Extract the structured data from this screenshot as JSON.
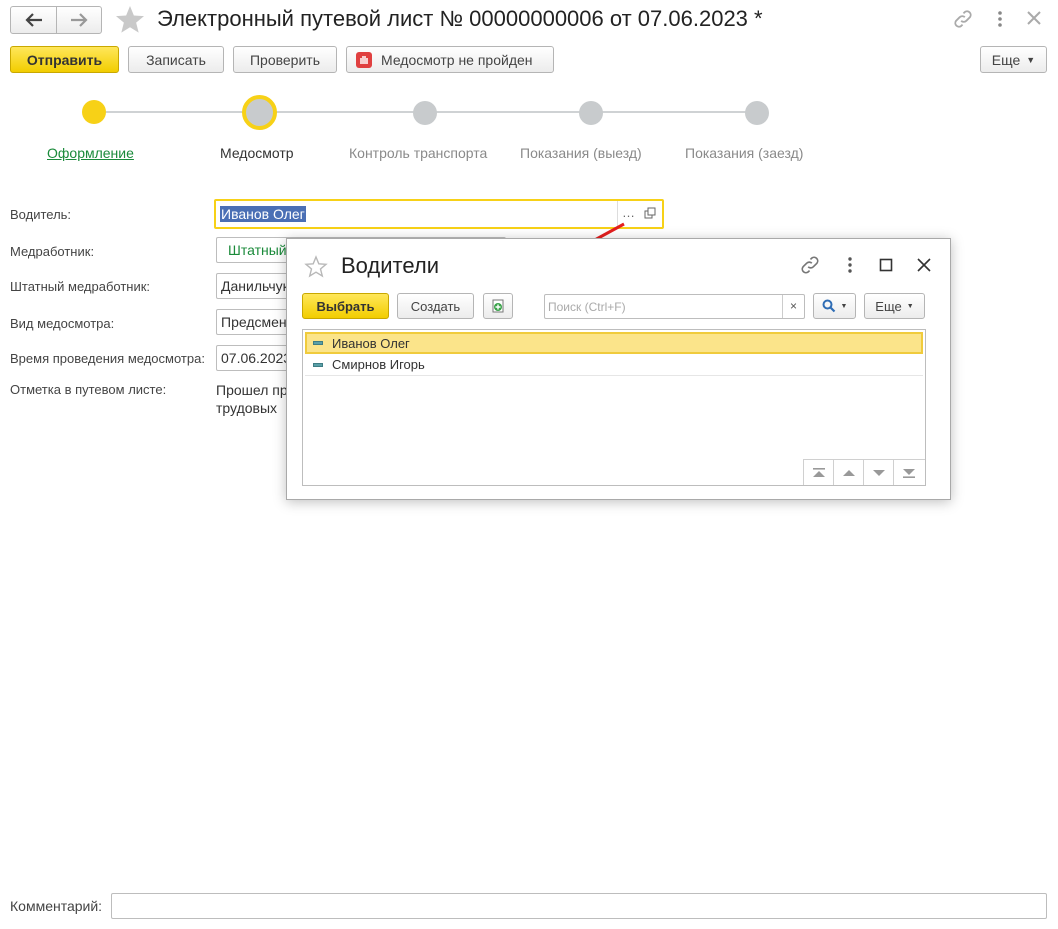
{
  "window": {
    "title": "Электронный путевой лист № 00000000006 от 07.06.2023 *"
  },
  "toolbar": {
    "send_label": "Отправить",
    "save_label": "Записать",
    "check_label": "Проверить",
    "medcheck_label": "Медосмотр не пройден",
    "more_label": "Еще"
  },
  "steps": [
    {
      "label": "Оформление",
      "state": "done"
    },
    {
      "label": "Медосмотр",
      "state": "current"
    },
    {
      "label": "Контроль транспорта",
      "state": "pending"
    },
    {
      "label": "Показания (выезд)",
      "state": "pending"
    },
    {
      "label": "Показания (заезд)",
      "state": "pending"
    }
  ],
  "form": {
    "driver_label": "Водитель:",
    "driver_value": "Иванов Олег",
    "medic_label": "Медработник:",
    "medic_value": "Штатный",
    "staff_medic_label": "Штатный медработник:",
    "staff_medic_value": "Данильчук",
    "exam_type_label": "Вид медосмотра:",
    "exam_type_value": "Предсмен",
    "exam_time_label": "Время проведения медосмотра:",
    "exam_time_value": "07.06.2023",
    "mark_label": "Отметка в путевом листе:",
    "mark_line1": "Прошел пр",
    "mark_line2": "трудовых",
    "comment_label": "Комментарий:",
    "comment_value": ""
  },
  "popup": {
    "title": "Водители",
    "select_label": "Выбрать",
    "create_label": "Создать",
    "search_placeholder": "Поиск (Ctrl+F)",
    "more_label": "Еще",
    "rows": [
      {
        "name": "Иванов Олег",
        "selected": true
      },
      {
        "name": "Смирнов Игорь",
        "selected": false
      }
    ]
  },
  "colors": {
    "accent_yellow": "#f7d117",
    "link_green": "#1a8a3a",
    "selection_blue": "#4a6fb5",
    "arrow_red": "#e31e1e"
  }
}
